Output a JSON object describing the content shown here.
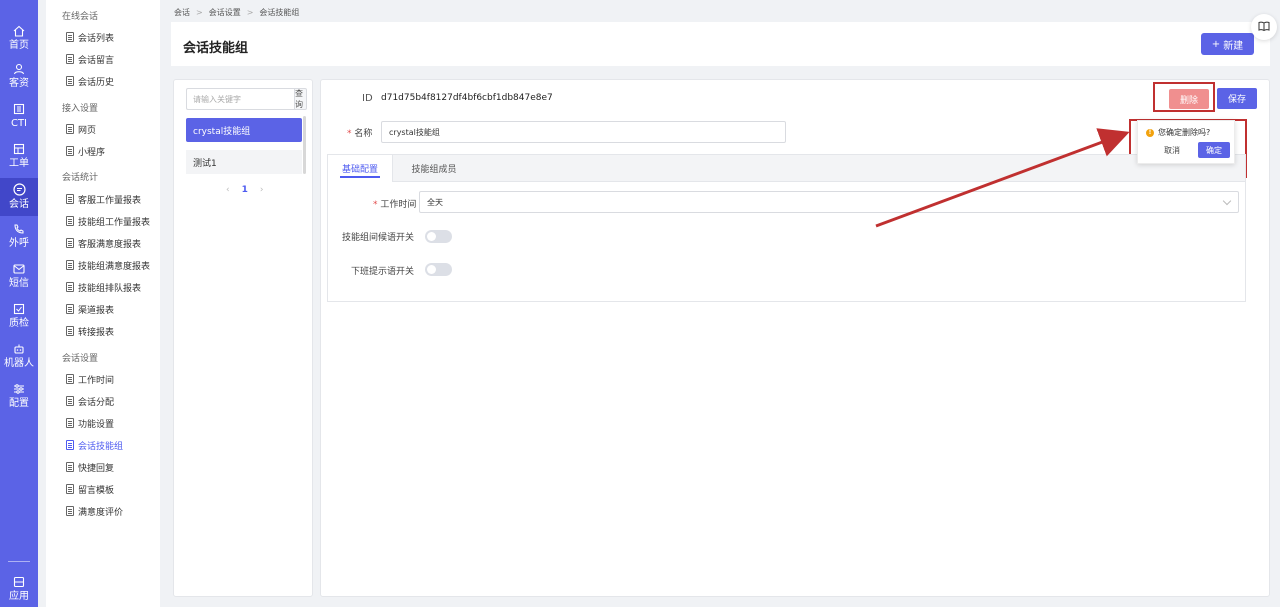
{
  "rail": {
    "items": [
      {
        "label": "首页",
        "icon": "home-icon"
      },
      {
        "label": "客资",
        "icon": "customers-icon"
      },
      {
        "label": "CTI",
        "icon": "cti-icon"
      },
      {
        "label": "工单",
        "icon": "ticket-icon"
      },
      {
        "label": "会话",
        "icon": "chat-icon",
        "active": true
      },
      {
        "label": "外呼",
        "icon": "outbound-call-icon"
      },
      {
        "label": "短信",
        "icon": "sms-icon"
      },
      {
        "label": "质检",
        "icon": "quality-check-icon"
      },
      {
        "label": "机器人",
        "icon": "robot-icon"
      },
      {
        "label": "配置",
        "icon": "config-icon"
      }
    ],
    "bottom": {
      "label": "应用",
      "icon": "apps-icon"
    }
  },
  "menu": {
    "groups": [
      {
        "title": "在线会话",
        "items": [
          "会话列表",
          "会话留言",
          "会话历史"
        ]
      },
      {
        "title": "接入设置",
        "items": [
          "网页",
          "小程序"
        ]
      },
      {
        "title": "会话统计",
        "items": [
          "客服工作量报表",
          "技能组工作量报表",
          "客服满意度报表",
          "技能组满意度报表",
          "技能组排队报表",
          "渠道报表",
          "转接报表"
        ]
      },
      {
        "title": "会话设置",
        "items": [
          "工作时间",
          "会话分配",
          "功能设置",
          "会话技能组",
          "快捷回复",
          "留言模板",
          "满意度评价"
        ]
      }
    ],
    "active_item": "会话技能组"
  },
  "breadcrumb": [
    "会话",
    "会话设置",
    "会话技能组"
  ],
  "header": {
    "title": "会话技能组",
    "new_button": "新建"
  },
  "list": {
    "search_placeholder": "请输入关键字",
    "search_button": "查询",
    "items": [
      "crystal技能组",
      "测试1"
    ],
    "pager": {
      "prev": "‹",
      "current": "1",
      "next": "›"
    }
  },
  "detail": {
    "id_label": "ID",
    "id_value": "d71d75b4f8127df4bf6cbf1db847e8e7",
    "delete_button": "删除",
    "save_button": "保存",
    "name_label": "名称",
    "name_value": "crystal技能组",
    "tabs": [
      "基础配置",
      "技能组成员"
    ],
    "work_time_label": "工作时间",
    "work_time_value": "全天",
    "greeting_switch_label": "技能组间候语开关",
    "offduty_switch_label": "下班提示语开关",
    "greeting_on": false,
    "offduty_on": false
  },
  "popconfirm": {
    "message": "您确定删除吗?",
    "cancel": "取消",
    "confirm": "确定"
  },
  "colors": {
    "brand": "#5b63e6",
    "danger_light": "#f08f8f",
    "annotation": "#c03030"
  }
}
